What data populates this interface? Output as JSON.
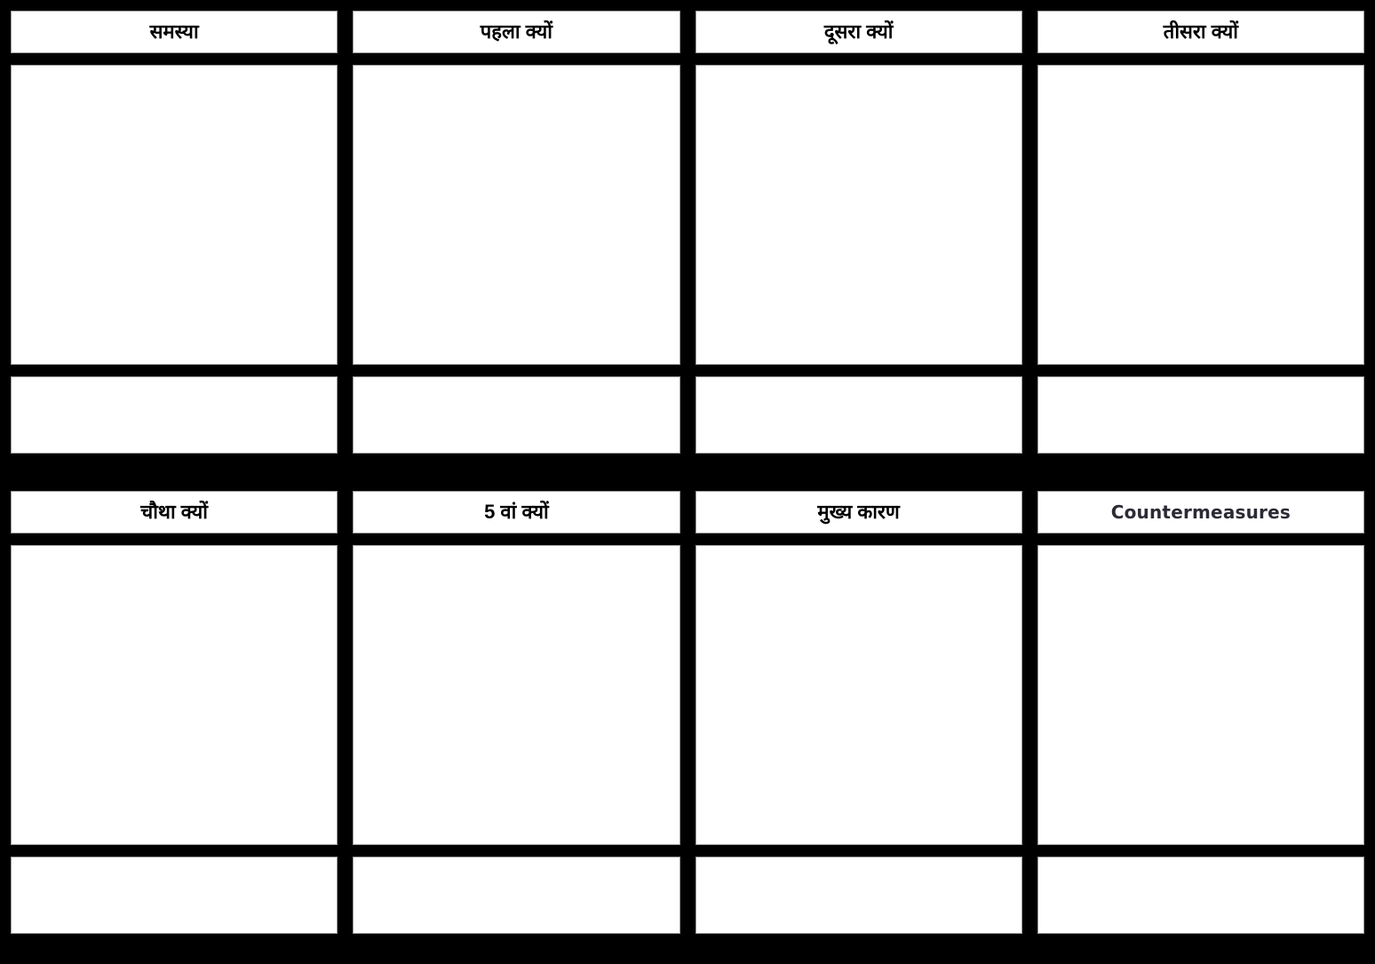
{
  "worksheet": {
    "background_color": "#000000",
    "cell_background_color": "#ffffff",
    "cell_border_color": "#9a9a9a",
    "devanagari_text_color": "#000000",
    "latin_text_color": "#2b2b35",
    "row_groups": [
      {
        "columns": [
          {
            "header": "समस्या",
            "script": "devanagari",
            "body_text": "",
            "note_text": ""
          },
          {
            "header": "पहला क्यों",
            "script": "devanagari",
            "body_text": "",
            "note_text": ""
          },
          {
            "header": "दूसरा क्यों",
            "script": "devanagari",
            "body_text": "",
            "note_text": ""
          },
          {
            "header": "तीसरा क्यों",
            "script": "devanagari",
            "body_text": "",
            "note_text": ""
          }
        ]
      },
      {
        "columns": [
          {
            "header": "चौथा क्यों",
            "script": "devanagari",
            "body_text": "",
            "note_text": ""
          },
          {
            "header": "5 वां क्यों",
            "script": "devanagari",
            "body_text": "",
            "note_text": ""
          },
          {
            "header": "मुख्य कारण",
            "script": "devanagari",
            "body_text": "",
            "note_text": ""
          },
          {
            "header": "Countermeasures",
            "script": "latin",
            "body_text": "",
            "note_text": ""
          }
        ]
      }
    ]
  }
}
